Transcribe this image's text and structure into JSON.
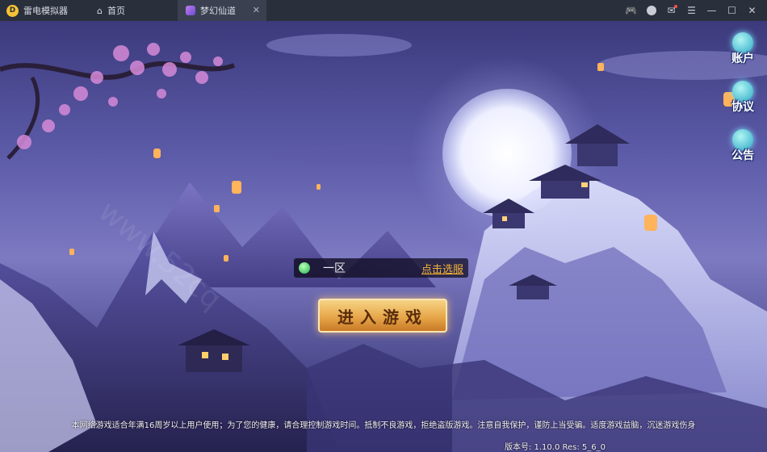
{
  "titlebar": {
    "app_name": "雷电模拟器",
    "tabs": [
      {
        "label": "首页",
        "icon": "home-icon"
      },
      {
        "label": "梦幻仙道",
        "icon": "game-icon"
      }
    ],
    "tools": [
      "gamepad-icon",
      "avatar-icon",
      "mail-icon",
      "menu-icon",
      "minimize-icon",
      "maximize-icon",
      "close-icon"
    ]
  },
  "sidebar": {
    "items": [
      {
        "label": "账户",
        "icon": "account-icon"
      },
      {
        "label": "协议",
        "icon": "agreement-icon"
      },
      {
        "label": "公告",
        "icon": "announcement-icon"
      }
    ]
  },
  "server": {
    "name": "一区",
    "select_label": "点击选服"
  },
  "enter_button": {
    "label": "进入游戏"
  },
  "footer": {
    "notice": "本网络游戏适合年满16周岁以上用户使用；为了您的健康，请合理控制游戏时间。抵制不良游戏，拒绝盗版游戏。注意自我保护，谨防上当受骗。适度游戏益脑，沉迷游戏伤身",
    "version": "版本号: 1.10.0  Res: 5_6_0"
  },
  "colors": {
    "titlebar_bg": "#2a2f3c",
    "server_select": "#f3b136",
    "button_gold": "#e7a749"
  }
}
